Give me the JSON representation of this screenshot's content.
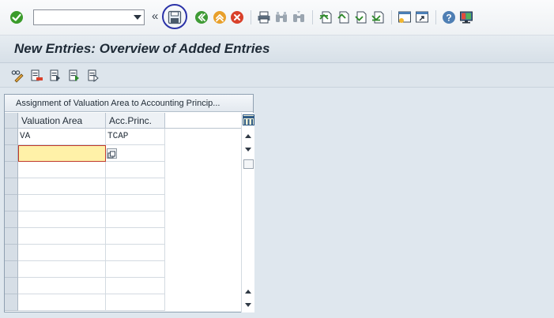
{
  "toolbar": {
    "command_value": "",
    "expander_glyph": "«",
    "icons": [
      "enter-icon",
      "save-icon",
      "back-icon",
      "exit-icon",
      "cancel-icon",
      "print-icon",
      "find-icon",
      "find-next-icon",
      "first-page-icon",
      "previous-page-icon",
      "next-page-icon",
      "last-page-icon",
      "create-session-icon",
      "shortcut-icon",
      "help-icon",
      "customize-layout-icon"
    ],
    "colors": {
      "enter": "#3a9b2a",
      "back": "#3f9b36",
      "exit": "#e8a02b",
      "cancel": "#d9412b",
      "highlight_ring": "#2b33a8"
    }
  },
  "title": {
    "text": "New Entries: Overview of Added Entries"
  },
  "app_toolbar": {
    "icons": [
      "change-display-icon",
      "delete-icon",
      "select-all-icon",
      "select-block-icon",
      "deselect-all-icon"
    ]
  },
  "table_control": {
    "title": "Assignment of Valuation Area to Accounting Princip...",
    "columns": [
      {
        "label": "Valuation Area"
      },
      {
        "label": "Acc.Princ."
      }
    ],
    "rows": [
      [
        "VA",
        "TCAP"
      ],
      [
        "",
        ""
      ],
      [
        "",
        ""
      ],
      [
        "",
        ""
      ],
      [
        "",
        ""
      ],
      [
        "",
        ""
      ],
      [
        "",
        ""
      ],
      [
        "",
        ""
      ],
      [
        "",
        ""
      ],
      [
        "",
        ""
      ],
      [
        "",
        ""
      ]
    ],
    "active_row": 1,
    "active_column": 0,
    "active_color": "#fff1a8"
  }
}
